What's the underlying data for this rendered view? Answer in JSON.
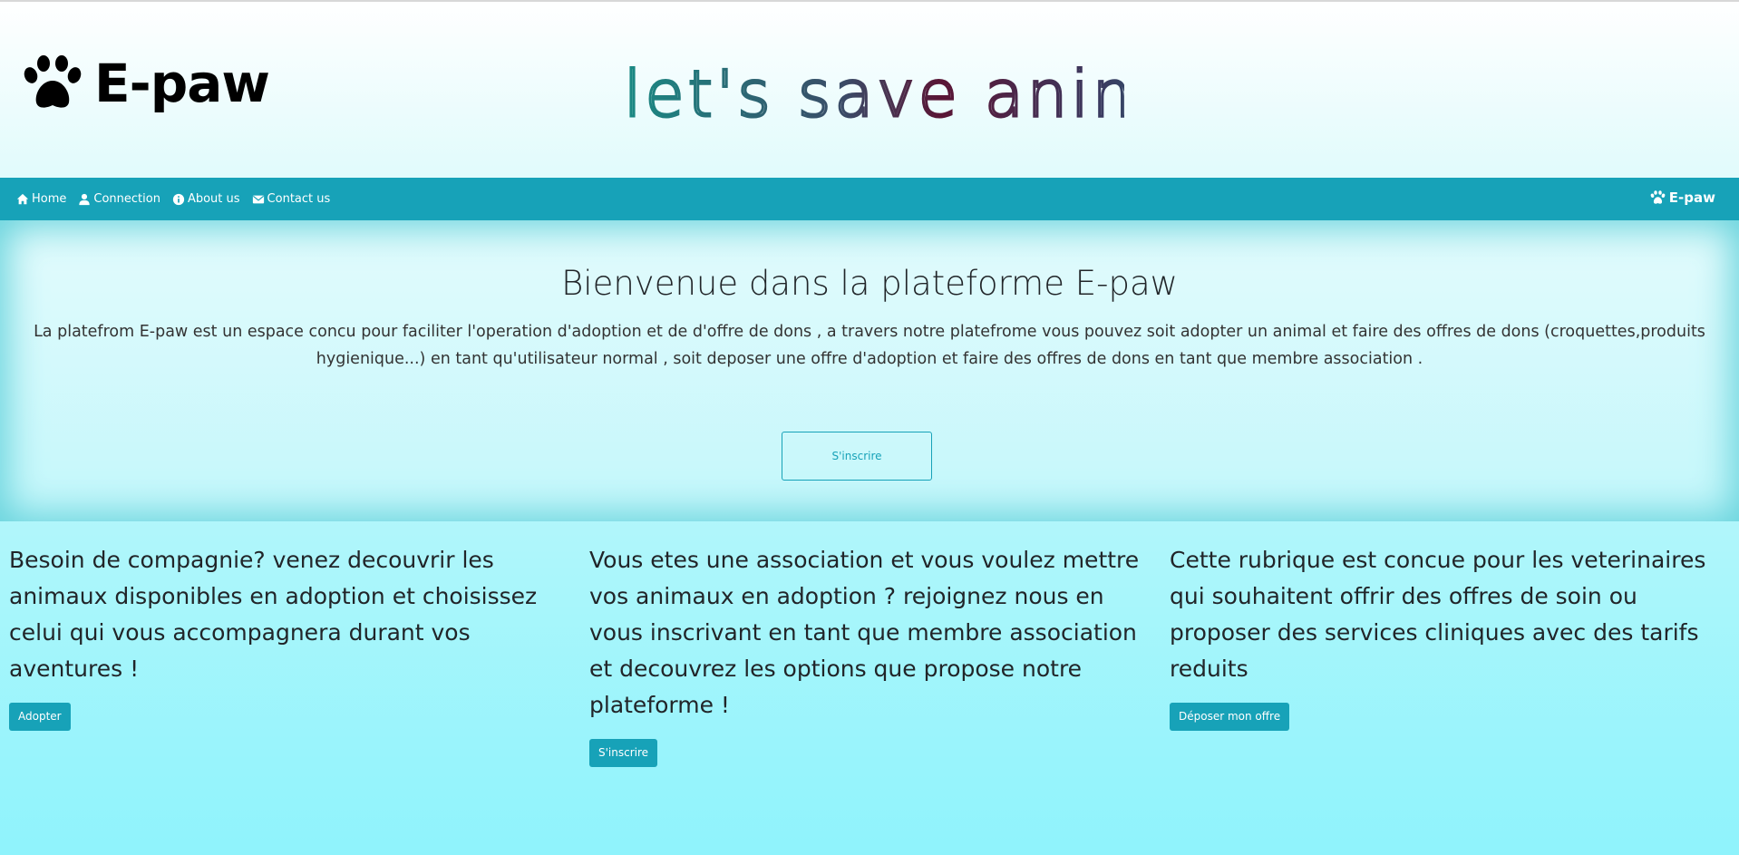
{
  "header": {
    "brand_name": "E-paw",
    "banner_text": "let's save animals",
    "banner_colors": [
      "#1a8a84",
      "#2d5f6e",
      "#5a1535",
      "#3a2a55",
      "#1f6d78"
    ]
  },
  "navbar": {
    "items": [
      {
        "label": "Home",
        "icon": "home-icon"
      },
      {
        "label": "Connection",
        "icon": "user-icon"
      },
      {
        "label": "About us",
        "icon": "info-icon"
      },
      {
        "label": "Contact us",
        "icon": "envelope-icon"
      }
    ],
    "brand": "E-paw",
    "color": "#17a2b8"
  },
  "jumbotron": {
    "title": "Bienvenue dans la plateforme E-paw",
    "text_line1": "La platefrom E-paw est un espace concu pour faciliter l'operation d'adoption et de d'offre de dons , a travers notre platefrome vous pouvez soit adopter un animal et faire des offres de dons (croquettes,produits",
    "text_line2": "hygienique...) en tant qu'utilisateur normal , soit deposer une offre d'adoption et faire des offres de dons en tant que membre association .",
    "button": "S'inscrire"
  },
  "columns": [
    {
      "text": "Besoin de compagnie? venez decouvrir les animaux disponibles en adoption et choisissez celui qui vous accompagnera durant vos aventures !",
      "button": "Adopter"
    },
    {
      "text": "Vous etes une association et vous voulez mettre vos animaux en adoption ? rejoignez nous en vous inscrivant en tant que membre association et decouvrez les options que propose notre plateforme !",
      "button": "S'inscrire"
    },
    {
      "text": "Cette rubrique est concue pour les veterinaires qui souhaitent offrir des offres de soin ou proposer des services cliniques avec des tarifs reduits",
      "button": "Déposer mon offre"
    }
  ]
}
